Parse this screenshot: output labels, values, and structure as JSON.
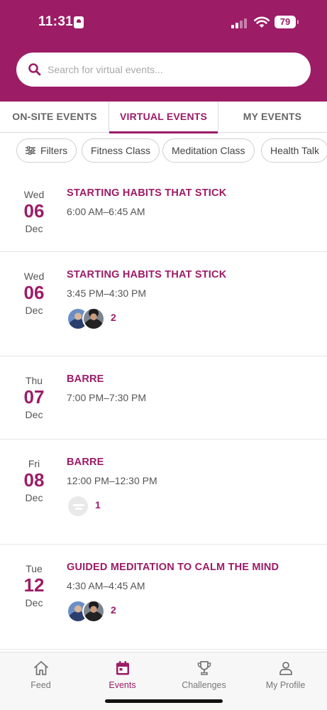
{
  "status_bar": {
    "time": "11:31",
    "battery": "79"
  },
  "search": {
    "placeholder": "Search for virtual events..."
  },
  "tabs": [
    {
      "label": "ON-SITE EVENTS",
      "active": false
    },
    {
      "label": "VIRTUAL EVENTS",
      "active": true
    },
    {
      "label": "MY EVENTS",
      "active": false
    }
  ],
  "chips": [
    {
      "label": "Filters",
      "icon": "filter-icon"
    },
    {
      "label": "Fitness Class"
    },
    {
      "label": "Meditation Class"
    },
    {
      "label": "Health Talk"
    }
  ],
  "events": [
    {
      "dow": "Wed",
      "day": "06",
      "month": "Dec",
      "title": "STARTING HABITS THAT STICK",
      "time": "6:00 AM–6:45 AM"
    },
    {
      "dow": "Wed",
      "day": "06",
      "month": "Dec",
      "title": "STARTING HABITS THAT STICK",
      "time": "3:45 PM–4:30 PM",
      "attendee_count": "2"
    },
    {
      "dow": "Thu",
      "day": "07",
      "month": "Dec",
      "title": "BARRE",
      "time": "7:00 PM–7:30 PM"
    },
    {
      "dow": "Fri",
      "day": "08",
      "month": "Dec",
      "title": "BARRE",
      "time": "12:00 PM–12:30 PM",
      "attendee_count": "1"
    },
    {
      "dow": "Tue",
      "day": "12",
      "month": "Dec",
      "title": "GUIDED MEDITATION TO CALM THE MIND",
      "time": "4:30 AM–4:45 AM",
      "attendee_count": "2"
    }
  ],
  "bottom_nav": [
    {
      "label": "Feed",
      "icon": "home-icon",
      "active": false
    },
    {
      "label": "Events",
      "icon": "calendar-icon",
      "active": true
    },
    {
      "label": "Challenges",
      "icon": "trophy-icon",
      "active": false
    },
    {
      "label": "My Profile",
      "icon": "person-icon",
      "active": false
    }
  ],
  "colors": {
    "brand": "#9c1c66",
    "text": "#555555",
    "nav_background": "#f7f7f7"
  }
}
